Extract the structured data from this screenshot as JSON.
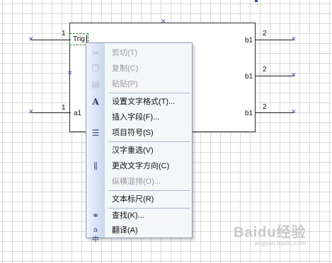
{
  "diagram": {
    "input_ports": [
      {
        "label": "Trig",
        "pin": "1"
      },
      {
        "label": "a1",
        "pin": "1"
      }
    ],
    "output_ports": [
      {
        "label": "b1",
        "pin": "2"
      },
      {
        "label": "b1",
        "pin": "2"
      },
      {
        "label": "b1",
        "pin": "2"
      }
    ]
  },
  "context_menu": {
    "items": [
      {
        "label": "剪切(T)",
        "icon": "scissors-icon",
        "enabled": false
      },
      {
        "label": "复制(C)",
        "icon": "copy-icon",
        "enabled": false
      },
      {
        "label": "粘贴(P)",
        "icon": "paste-icon",
        "enabled": false
      },
      {
        "label": "设置文字格式(T)...",
        "icon": "font-A-icon",
        "enabled": true
      },
      {
        "label": "插入字段(F)...",
        "icon": "",
        "enabled": true
      },
      {
        "label": "项目符号(S)",
        "icon": "bullet-list-icon",
        "enabled": true
      },
      {
        "label": "汉字重选(V)",
        "icon": "",
        "enabled": true
      },
      {
        "label": "更改文字方向(C)",
        "icon": "text-direction-icon",
        "enabled": true
      },
      {
        "label": "纵横混排(O)...",
        "icon": "",
        "enabled": false
      },
      {
        "label": "文本标尺(R)",
        "icon": "",
        "enabled": true
      },
      {
        "label": "查找(K)...",
        "icon": "binoculars-icon",
        "enabled": true
      },
      {
        "label": "翻译(A)",
        "icon": "translate-icon",
        "enabled": true
      }
    ]
  },
  "watermark": {
    "text": "Baidu经验",
    "sub": "jingyan.baidu.com"
  }
}
